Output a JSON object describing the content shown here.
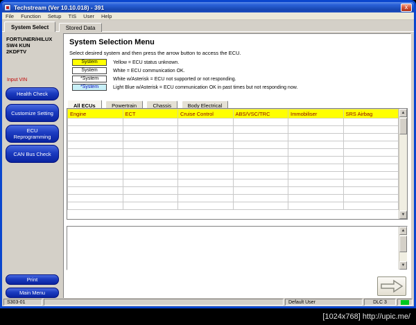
{
  "window": {
    "title": "Techstream (Ver 10.10.018) - 391",
    "close_glyph": "x"
  },
  "menu": {
    "items": [
      "File",
      "Function",
      "Setup",
      "TIS",
      "User",
      "Help"
    ]
  },
  "main_tabs": [
    {
      "label": "System Select"
    },
    {
      "label": "Stored Data"
    }
  ],
  "sidebar": {
    "vehicle_lines": [
      "FORTUNER/HILUX",
      "SW4 KUN",
      "2KDFTV"
    ],
    "input_vin_label": "Input VIN",
    "buttons": {
      "health_check": "Health Check",
      "customize_setting": "Customize Setting",
      "ecu_reprogramming": "ECU Reprogramming",
      "can_bus_check": "CAN Bus Check",
      "print": "Print",
      "main_menu": "Main Menu"
    }
  },
  "content": {
    "title": "System Selection Menu",
    "instruction": "Select desired system and then press the arrow button to access the ECU.",
    "legend": [
      {
        "box": "System",
        "text": "Yellow = ECU status unknown."
      },
      {
        "box": "System",
        "text": "White = ECU communication OK."
      },
      {
        "box": "*System",
        "text": "White w/Asterisk = ECU not supported or not responding."
      },
      {
        "box": "*System",
        "text": "Light Blue w/Asterisk = ECU communication OK in past times but not responding now."
      }
    ],
    "ecu_tabs": [
      "All ECUs",
      "Powertrain",
      "Chassis",
      "Body Electrical"
    ],
    "ecu_table": {
      "columns": [
        "Engine",
        "ECT",
        "Cruise Control",
        "ABS/VSC/TRC",
        "Immobiliser",
        "SRS Airbag"
      ],
      "empty_row_count": 12
    },
    "scroll_up_glyph": "▲",
    "scroll_down_glyph": "▼"
  },
  "statusbar": {
    "code": "S303-01",
    "user": "Default User",
    "dlc": "DLC 3"
  },
  "watermark": "[1024x768] http://upic.me/",
  "colors": {
    "accent_blue": "#1B3BC0",
    "status_yellow": "#FFFF00",
    "status_light_blue": "#C8F0F8",
    "lamp_green": "#00C81E"
  }
}
